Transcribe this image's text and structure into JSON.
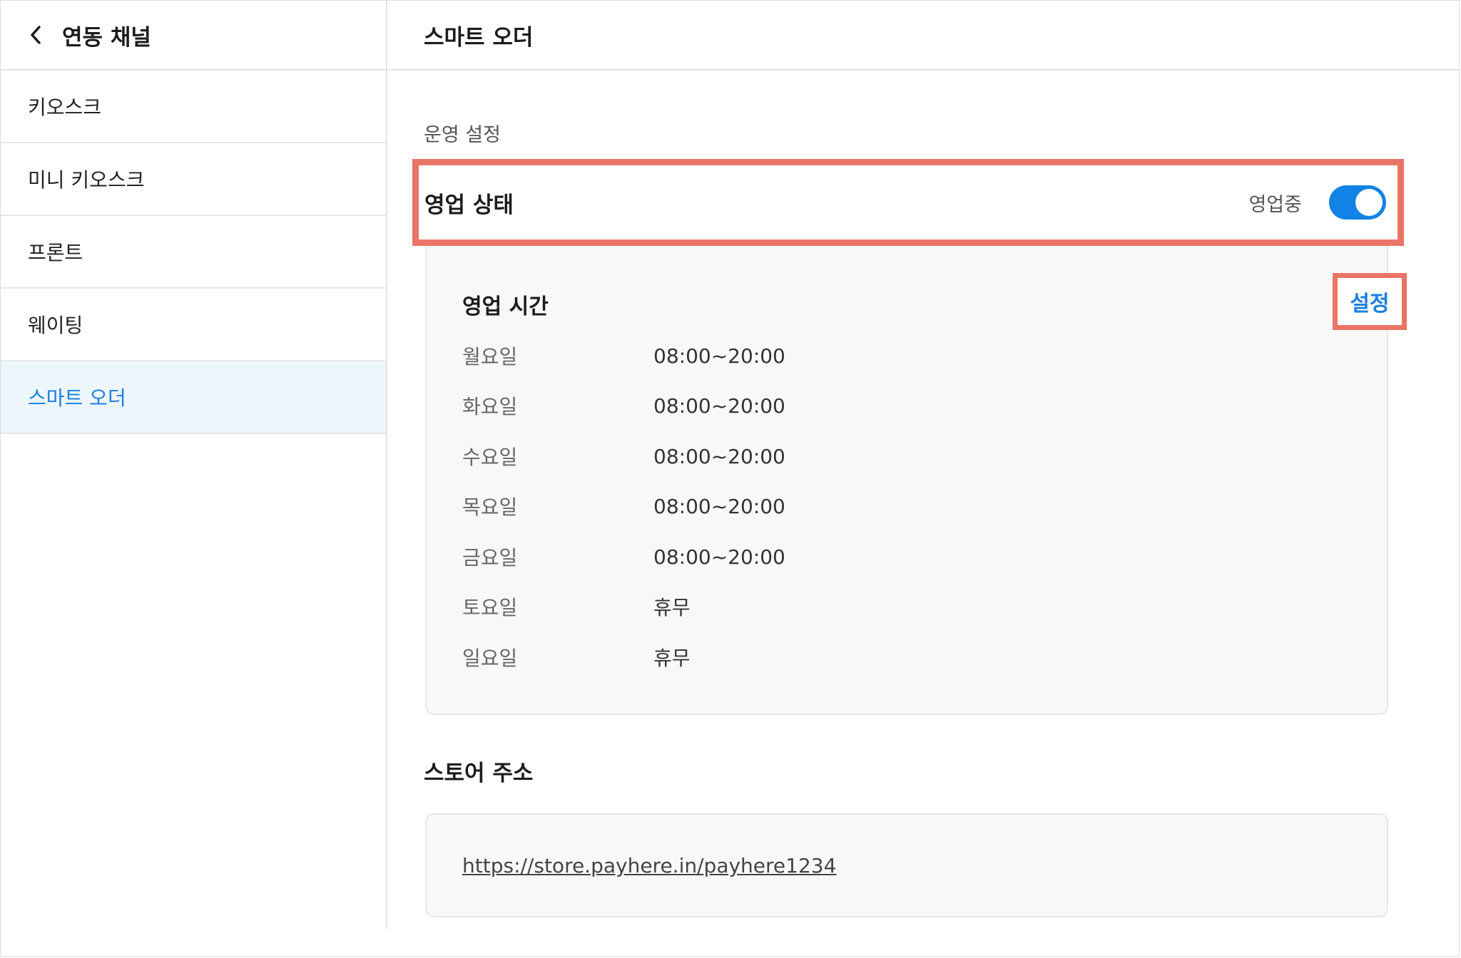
{
  "sidebar": {
    "title": "연동 채널",
    "items": [
      {
        "label": "키오스크"
      },
      {
        "label": "미니 키오스크"
      },
      {
        "label": "프론트"
      },
      {
        "label": "웨이팅"
      },
      {
        "label": "스마트 오더",
        "active": true
      }
    ]
  },
  "main": {
    "title": "스마트 오더",
    "section_label": "운영 설정",
    "status": {
      "label": "영업 상태",
      "value": "영업중",
      "toggle_on": true
    },
    "hours": {
      "title": "영업 시간",
      "settings_label": "설정",
      "rows": [
        {
          "day": "월요일",
          "time": "08:00~20:00"
        },
        {
          "day": "화요일",
          "time": "08:00~20:00"
        },
        {
          "day": "수요일",
          "time": "08:00~20:00"
        },
        {
          "day": "목요일",
          "time": "08:00~20:00"
        },
        {
          "day": "금요일",
          "time": "08:00~20:00"
        },
        {
          "day": "토요일",
          "time": "휴무"
        },
        {
          "day": "일요일",
          "time": "휴무"
        }
      ]
    },
    "store": {
      "title": "스토어 주소",
      "url": "https://store.payhere.in/payhere1234"
    }
  },
  "colors": {
    "accent": "#1a7fe0",
    "toggle": "#1283e6",
    "highlight": "#ea7566",
    "active_bg": "#eef6fd"
  }
}
